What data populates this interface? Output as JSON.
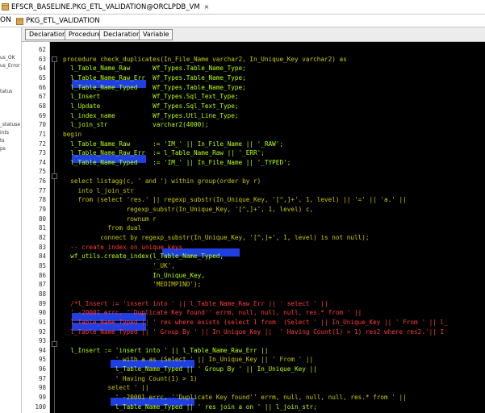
{
  "colors": {
    "keyword": "#c8c800",
    "string": "#c8c800",
    "comment": "#ff3a3a",
    "ident": "#b8ff00",
    "selection": "#1f3fe0"
  },
  "window": {
    "tab_title": "EFSCR_BASELINE.PKG_ETL_VALIDATION@ORCLPDB_VM",
    "close_symbol": "×"
  },
  "subtab": {
    "title": "PKG_ETL_VALIDATION",
    "left_label": "ON"
  },
  "left_panel": {
    "items": [
      "us_OK",
      "us_Error",
      "tatus",
      "_statuse",
      "ints",
      "ts",
      "ps"
    ]
  },
  "toolbar": {
    "buttons": [
      "Declaration",
      "Procedure",
      "Declaration",
      "Variable"
    ]
  },
  "editor": {
    "lines": [
      {
        "n": "62",
        "t": "",
        "c": "comment"
      },
      {
        "n": "63",
        "t": "procedure check_duplicates(In_File_Name varchar2, In_Unique_Key varchar2) as",
        "c": "keyword"
      },
      {
        "n": "64",
        "t": "  l_Table_Name_Raw      Wf_Types.Table_Name_Type;",
        "c": "ident"
      },
      {
        "n": "65",
        "t": "  l_Table_Name_Raw_Err  Wf_Types.Table_Name_Type;",
        "c": "ident"
      },
      {
        "n": "66",
        "t": "  l_Table_Name_Typed    Wf_Types.Table_Name_Type;",
        "c": "ident"
      },
      {
        "n": "67",
        "t": "  l_Insert              Wf_Types.Sql_Text_Type;",
        "c": "ident"
      },
      {
        "n": "68",
        "t": "  l_Update              Wf_Types.Sql_Text_Type;",
        "c": "ident"
      },
      {
        "n": "69",
        "t": "  l_index_name          Wf_Types.Utl_Line_Type;",
        "c": "ident"
      },
      {
        "n": "70",
        "t": "  l_join_str            varchar2(4000);",
        "c": "ident"
      },
      {
        "n": "71",
        "t": "begin",
        "c": "keyword"
      },
      {
        "n": "72",
        "t": "  l_Table_Name_Raw      := 'IM_' || In_File_Name || '_RAW';",
        "c": "ident"
      },
      {
        "n": "73",
        "t": "  l_Table_Name_Raw_Err  := l_Table_Name_Raw || '_ERR';",
        "c": "ident"
      },
      {
        "n": "74",
        "t": "  l_Table_Name_Typed    := 'IM_' || In_File_Name || '_TYPED';",
        "c": "ident"
      },
      {
        "n": "75",
        "t": "",
        "c": "ident"
      },
      {
        "n": "76",
        "t": "  select listagg(c, ' and ') within group(order by r)",
        "c": "keyword"
      },
      {
        "n": "77",
        "t": "    into l_join_str",
        "c": "keyword"
      },
      {
        "n": "78",
        "t": "    from (select 'res.' || regexp_substr(In_Unique_Key, '[^,]+', 1, level) || '=' || 'a.' ||",
        "c": "keyword"
      },
      {
        "n": "79",
        "t": "                 regexp_substr(In_Unique_Key, '[^,]+', 1, level) c,",
        "c": "keyword"
      },
      {
        "n": "80",
        "t": "                 rownum r",
        "c": "keyword"
      },
      {
        "n": "81",
        "t": "            from dual",
        "c": "keyword"
      },
      {
        "n": "82",
        "t": "          connect by regexp_substr(In_Unique_Key, '[^,]+', 1, level) is not null);",
        "c": "keyword"
      },
      {
        "n": "83",
        "t": "  -- create index on unique keys",
        "c": "comment"
      },
      {
        "n": "84",
        "t": "  wf_utils.create_index(l_Table_Name_Typed,",
        "c": "ident"
      },
      {
        "n": "85",
        "t": "                        '_UK',",
        "c": "string"
      },
      {
        "n": "86",
        "t": "                        In_Unique_Key,",
        "c": "ident"
      },
      {
        "n": "87",
        "t": "                        'MEDIMPIND');",
        "c": "string"
      },
      {
        "n": "88",
        "t": "",
        "c": "ident"
      },
      {
        "n": "89",
        "t": "  /*l_Insert := 'insert into ' || l_Table_Name_Raw_Err || ' select ' ||",
        "c": "comment"
      },
      {
        "n": "90",
        "t": "  ' -20001 errc, ''Duplicate Key found'' errm, null, null, null, res.* from ' ||",
        "c": "comment"
      },
      {
        "n": "91",
        "t": "  l_Table_Name_Typed || ' res where exists (select 1 from  (Select ' || In_Unique_Key || ' From ' || l_",
        "c": "comment"
      },
      {
        "n": "92",
        "t": "  l_Table_Name_Typed || ' Group By ' || In_Unique_Key ||  ' Having Count(1) > 1) res2 where res2.'|| I",
        "c": "comment"
      },
      {
        "n": "93",
        "t": "",
        "c": "ident"
      },
      {
        "n": "94",
        "t": "  l_Insert := 'insert into ' || l_Table_Name_Raw_Err ||",
        "c": "ident"
      },
      {
        "n": "95",
        "t": "              ' with a as (Select ' || In_Unique_Key || ' From ' ||",
        "c": "string"
      },
      {
        "n": "96",
        "t": "              l_Table_Name_Typed || ' Group By ' || In_Unique_Key ||",
        "c": "ident"
      },
      {
        "n": "97",
        "t": "              ' Having Count(1) > 1)",
        "c": "string"
      },
      {
        "n": "98",
        "t": "            select ' ||",
        "c": "string"
      },
      {
        "n": "99",
        "t": "              ' -20001 errc, ''Duplicate Key found'' errm, null, null, null, res.* from ' ||",
        "c": "string"
      },
      {
        "n": "100",
        "t": "              l_Table_Name_Typed || ' res join a on ' || l_join_str;",
        "c": "ident"
      }
    ]
  }
}
